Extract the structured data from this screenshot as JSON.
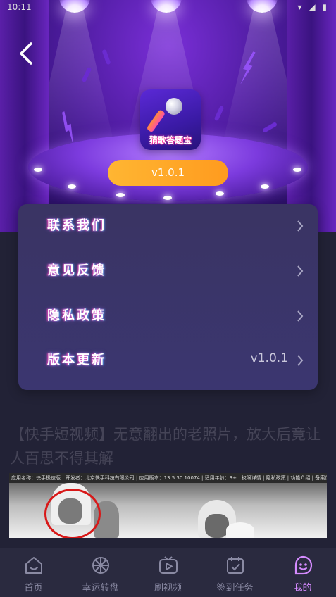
{
  "status_bar": {
    "time": "10:11",
    "icons": "▾ ◢ ▮"
  },
  "header": {
    "back_icon": "back-chevron-icon"
  },
  "app": {
    "icon_text": "猜歌答题宝",
    "version": "v1.0.1"
  },
  "menu": {
    "items": [
      {
        "label": "联系我们",
        "value": ""
      },
      {
        "label": "意见反馈",
        "value": ""
      },
      {
        "label": "隐私政策",
        "value": ""
      },
      {
        "label": "版本更新",
        "value": "v1.0.1"
      }
    ]
  },
  "article": {
    "title": "【快手短视频】无意翻出的老照片，放大后竟让人百思不得其解",
    "thumb_caption": "应用名称：快手极速版 | 开发者：北京快手科技有限公司 | 应用版本：13.5.30.10074 | 适用年龄：3+ | 权限详情 | 隐私政策 | 功能介绍 | 备案信息"
  },
  "bottom_nav": {
    "tabs": [
      {
        "label": "首页",
        "icon": "home-icon"
      },
      {
        "label": "幸运转盘",
        "icon": "wheel-icon"
      },
      {
        "label": "刷视频",
        "icon": "video-icon"
      },
      {
        "label": "签到任务",
        "icon": "calendar-check-icon"
      },
      {
        "label": "我的",
        "icon": "profile-face-icon"
      }
    ],
    "active_index": 4
  },
  "colors": {
    "accent": "#ffa826",
    "active_tab": "#d58bff",
    "card_bg": "#3a3463"
  }
}
